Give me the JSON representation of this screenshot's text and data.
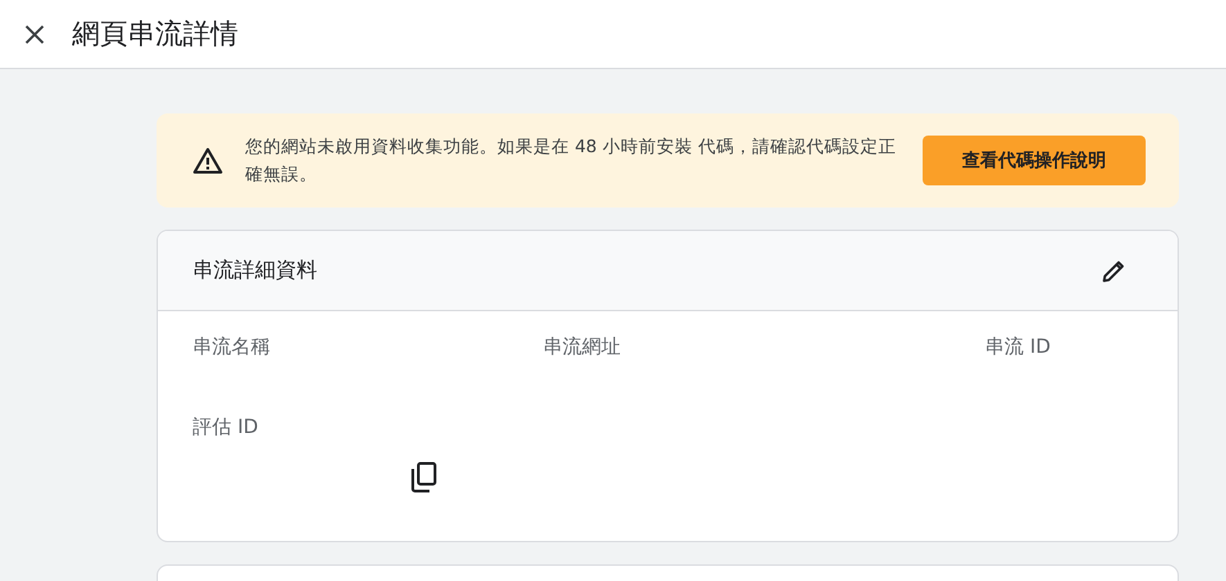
{
  "window": {
    "title": "網頁串流詳情"
  },
  "alert": {
    "message": "您的網站未啟用資料收集功能。如果是在 48 小時前安裝 代碼，請確認代碼設定正確無誤。",
    "action": "查看代碼操作說明"
  },
  "details_card": {
    "title": "串流詳細資料",
    "fields": [
      {
        "label": "串流名稱"
      },
      {
        "label": "串流網址"
      },
      {
        "label": "串流 ID"
      },
      {
        "label": "評估 ID"
      }
    ]
  }
}
